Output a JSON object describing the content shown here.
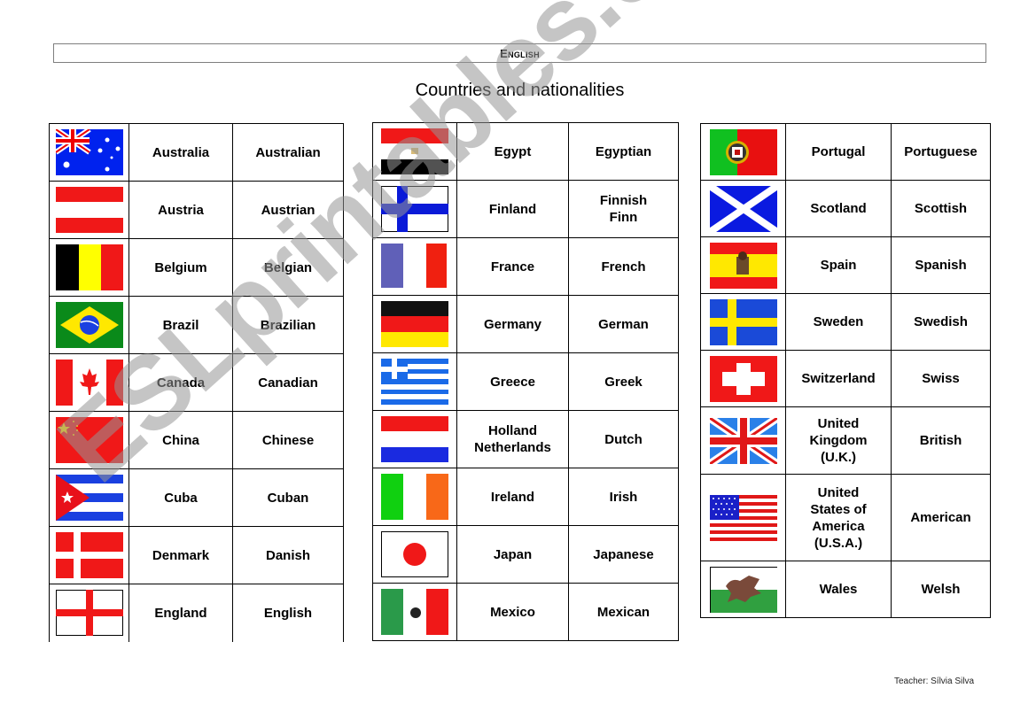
{
  "header": {
    "subject": "English"
  },
  "title": "Countries and nationalities",
  "watermark": "ESLprintables.com",
  "footer": {
    "teacher": "Teacher: Sílvia Silva"
  },
  "tables": [
    {
      "rows": [
        {
          "flag": "australia-flag-icon",
          "country": "Australia",
          "nationality": "Australian"
        },
        {
          "flag": "austria-flag-icon",
          "country": "Austria",
          "nationality": "Austrian"
        },
        {
          "flag": "belgium-flag-icon",
          "country": "Belgium",
          "nationality": "Belgian"
        },
        {
          "flag": "brazil-flag-icon",
          "country": "Brazil",
          "nationality": "Brazilian"
        },
        {
          "flag": "canada-flag-icon",
          "country": "Canada",
          "nationality": "Canadian"
        },
        {
          "flag": "china-flag-icon",
          "country": "China",
          "nationality": "Chinese"
        },
        {
          "flag": "cuba-flag-icon",
          "country": "Cuba",
          "nationality": "Cuban"
        },
        {
          "flag": "denmark-flag-icon",
          "country": "Denmark",
          "nationality": "Danish"
        },
        {
          "flag": "england-flag-icon",
          "country": "England",
          "nationality": "English"
        }
      ]
    },
    {
      "rows": [
        {
          "flag": "egypt-flag-icon",
          "country": "Egypt",
          "nationality": "Egyptian"
        },
        {
          "flag": "finland-flag-icon",
          "country": "Finland",
          "nationality": "Finnish\nFinn"
        },
        {
          "flag": "france-flag-icon",
          "country": "France",
          "nationality": "French"
        },
        {
          "flag": "germany-flag-icon",
          "country": "Germany",
          "nationality": "German"
        },
        {
          "flag": "greece-flag-icon",
          "country": "Greece",
          "nationality": "Greek"
        },
        {
          "flag": "netherlands-flag-icon",
          "country": "Holland\nNetherlands",
          "nationality": "Dutch"
        },
        {
          "flag": "ireland-flag-icon",
          "country": "Ireland",
          "nationality": "Irish"
        },
        {
          "flag": "japan-flag-icon",
          "country": "Japan",
          "nationality": "Japanese"
        },
        {
          "flag": "mexico-flag-icon",
          "country": "Mexico",
          "nationality": "Mexican"
        }
      ]
    },
    {
      "rows": [
        {
          "flag": "portugal-flag-icon",
          "country": "Portugal",
          "nationality": "Portuguese"
        },
        {
          "flag": "scotland-flag-icon",
          "country": "Scotland",
          "nationality": "Scottish"
        },
        {
          "flag": "spain-flag-icon",
          "country": "Spain",
          "nationality": "Spanish"
        },
        {
          "flag": "sweden-flag-icon",
          "country": "Sweden",
          "nationality": "Swedish"
        },
        {
          "flag": "switzerland-flag-icon",
          "country": "Switzerland",
          "nationality": "Swiss"
        },
        {
          "flag": "uk-flag-icon",
          "country": "United\nKingdom\n(U.K.)",
          "nationality": "British"
        },
        {
          "flag": "usa-flag-icon",
          "country": "United\nStates of\nAmerica\n(U.S.A.)",
          "nationality": "American"
        },
        {
          "flag": "wales-flag-icon",
          "country": "Wales",
          "nationality": "Welsh"
        }
      ]
    }
  ]
}
